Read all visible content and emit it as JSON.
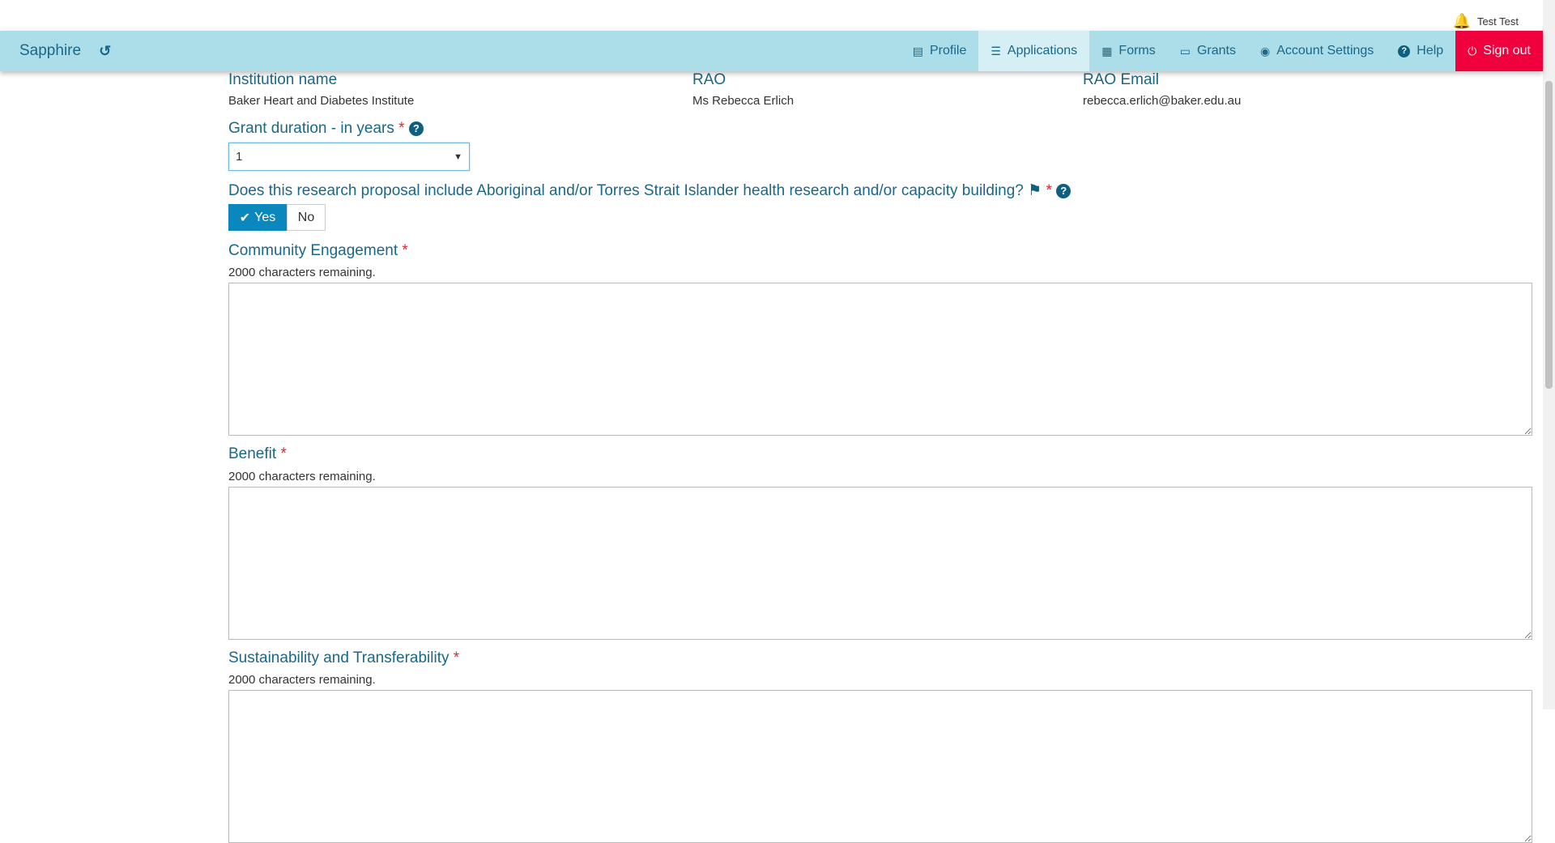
{
  "user": {
    "name": "Test Test",
    "icon": "bell-icon"
  },
  "nav": {
    "brand": "Sapphire",
    "history_icon": "history-icon",
    "items": [
      {
        "label": "Profile",
        "icon": "id-card-icon"
      },
      {
        "label": "Applications",
        "icon": "list-icon",
        "active": true
      },
      {
        "label": "Forms",
        "icon": "newspaper-icon"
      },
      {
        "label": "Grants",
        "icon": "desktop-icon"
      },
      {
        "label": "Account Settings",
        "icon": "user-circle-icon"
      },
      {
        "label": "Help",
        "icon": "question-circle-icon"
      }
    ],
    "signout": "Sign out"
  },
  "institution": {
    "label": "Institution name",
    "value": "Baker Heart and Diabetes Institute"
  },
  "rao": {
    "label": "RAO",
    "value": "Ms Rebecca Erlich"
  },
  "rao_email": {
    "label": "RAO Email",
    "value": "rebecca.erlich@baker.edu.au"
  },
  "grant_duration": {
    "label": "Grant duration - in years",
    "required": "*",
    "value": "1"
  },
  "atsi": {
    "label": "Does this research proposal include Aboriginal and/or Torres Strait Islander health research and/or capacity building?",
    "required": "*",
    "yes": "Yes",
    "no": "No",
    "selected": "Yes"
  },
  "fields": [
    {
      "label": "Community Engagement",
      "required": "*",
      "remaining": "2000 characters remaining.",
      "value": ""
    },
    {
      "label": "Benefit",
      "required": "*",
      "remaining": "2000 characters remaining.",
      "value": ""
    },
    {
      "label": "Sustainability and Transferability",
      "required": "*",
      "remaining": "2000 characters remaining.",
      "value": ""
    }
  ],
  "colors": {
    "nav": "#acdee9",
    "active": "#d5eff4",
    "signout": "#f0003c",
    "label": "#1a6787",
    "yes": "#0a87bd"
  }
}
